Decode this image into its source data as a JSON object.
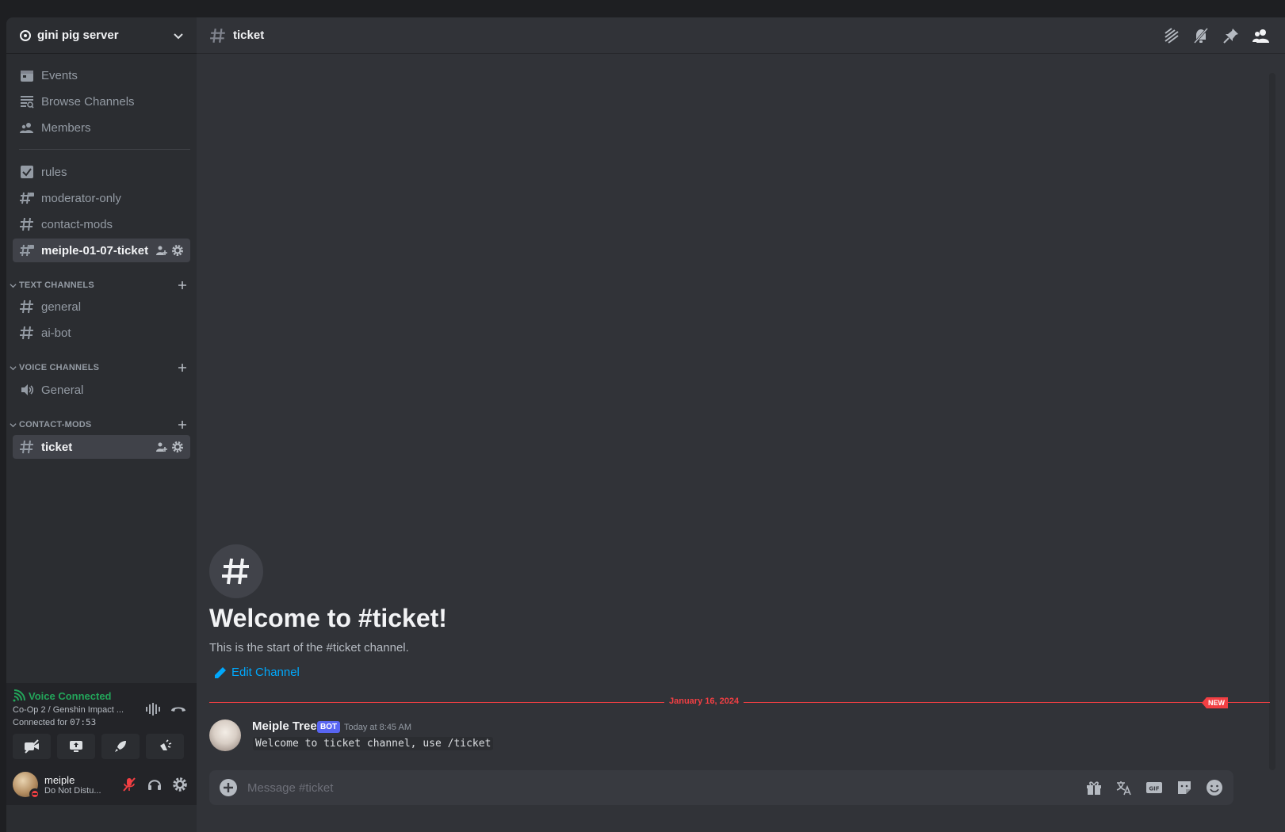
{
  "server": {
    "name": "gini pig server"
  },
  "nav": {
    "events": "Events",
    "browse": "Browse Channels",
    "members": "Members"
  },
  "top_channels": [
    {
      "name": "rules",
      "icon": "rules-checkbox-icon"
    },
    {
      "name": "moderator-only",
      "icon": "locked-hash-icon"
    },
    {
      "name": "contact-mods",
      "icon": "hash-icon"
    },
    {
      "name": "meiple-01-07-ticket",
      "icon": "locked-hash-icon"
    }
  ],
  "categories": {
    "text": "TEXT CHANNELS",
    "voice": "VOICE CHANNELS",
    "contact": "CONTACT-MODS"
  },
  "text_channels": [
    "general",
    "ai-bot"
  ],
  "voice_channels": [
    "General"
  ],
  "contact_channels": [
    "ticket"
  ],
  "voice_panel": {
    "status": "Voice Connected",
    "location": "Co-Op 2 / Genshin Impact ...",
    "connected_prefix": "Connected for",
    "connected_time": "07:53"
  },
  "user": {
    "name": "meiple",
    "status": "Do Not Distu..."
  },
  "channel": {
    "name": "ticket"
  },
  "welcome": {
    "title": "Welcome to #ticket!",
    "subtitle": "This is the start of the #ticket channel.",
    "edit_link": "Edit Channel"
  },
  "divider": {
    "date": "January 16, 2024",
    "new_badge": "NEW"
  },
  "message": {
    "author": "Meiple Tree",
    "tag": "BOT",
    "timestamp": "Today at 8:45 AM",
    "content": "Welcome to ticket channel, use /ticket"
  },
  "composer": {
    "placeholder": "Message #ticket"
  },
  "colors": {
    "accent": "#5865f2",
    "online": "#23a55a",
    "danger": "#f23f43",
    "link": "#00a8fc",
    "sidebar_bg": "#2b2d31",
    "main_bg": "#313338"
  }
}
